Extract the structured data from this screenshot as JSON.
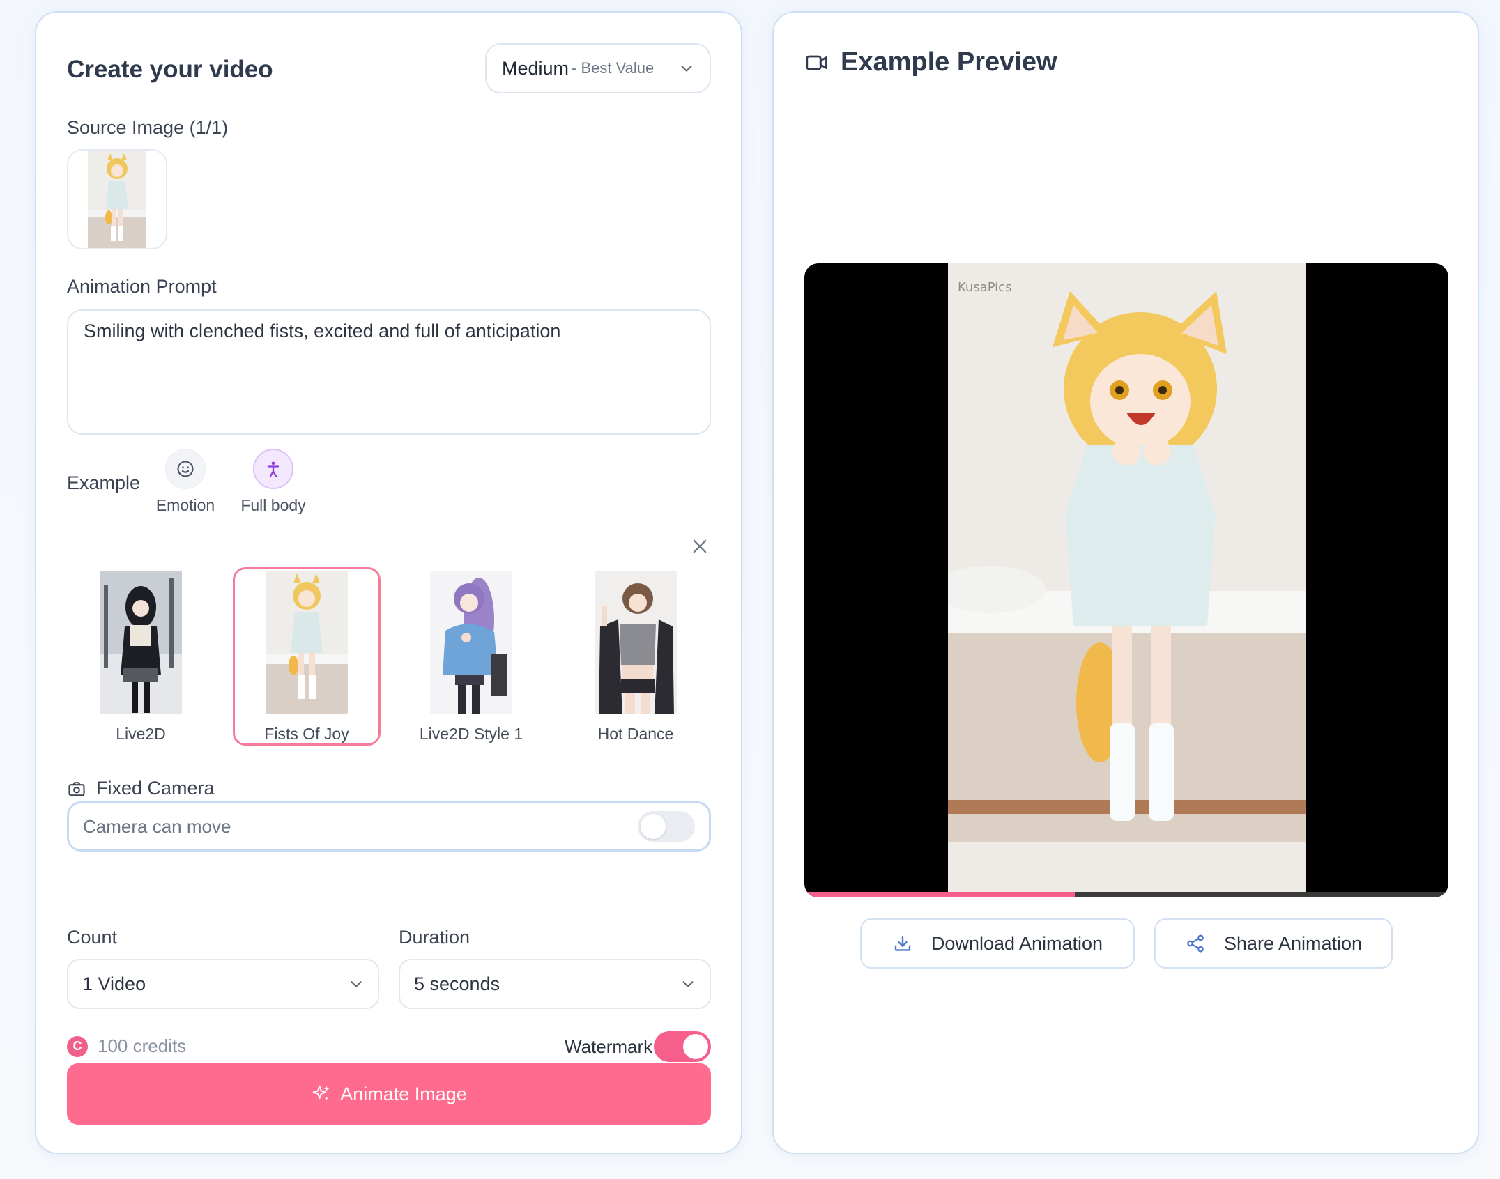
{
  "create": {
    "title": "Create your video",
    "quality": {
      "main": "Medium",
      "sub": "- Best Value"
    },
    "source_label": "Source Image (1/1)",
    "prompt_label": "Animation Prompt",
    "prompt_value": "Smiling with clenched fists, excited and full of anticipation",
    "example_label": "Example",
    "examples": [
      {
        "label": "Emotion",
        "icon": "smile-icon"
      },
      {
        "label": "Full body",
        "icon": "person-icon"
      }
    ],
    "styles": [
      {
        "label": "Live2D",
        "selected": false
      },
      {
        "label": "Fists Of Joy",
        "selected": true
      },
      {
        "label": "Live2D Style 1",
        "selected": false
      },
      {
        "label": "Hot Dance",
        "selected": false
      }
    ],
    "fixed_camera_label": "Fixed Camera",
    "camera_placeholder": "Camera can move",
    "camera_toggle_on": false,
    "count_label": "Count",
    "count_value": "1 Video",
    "duration_label": "Duration",
    "duration_value": "5 seconds",
    "credits": "100 credits",
    "credit_icon_letter": "C",
    "watermark_label": "Watermark",
    "watermark_on": true,
    "animate_label": "Animate Image"
  },
  "preview": {
    "title": "Example Preview",
    "progress": 0.42,
    "download_label": "Download Animation",
    "share_label": "Share Animation"
  },
  "colors": {
    "accent_pink": "#ff6b8e",
    "toggle_pink": "#f65f8b",
    "selected_border": "#f57b9a",
    "panel_border": "#cfe0f4",
    "fullbody_purple": "#8e3fd6"
  }
}
